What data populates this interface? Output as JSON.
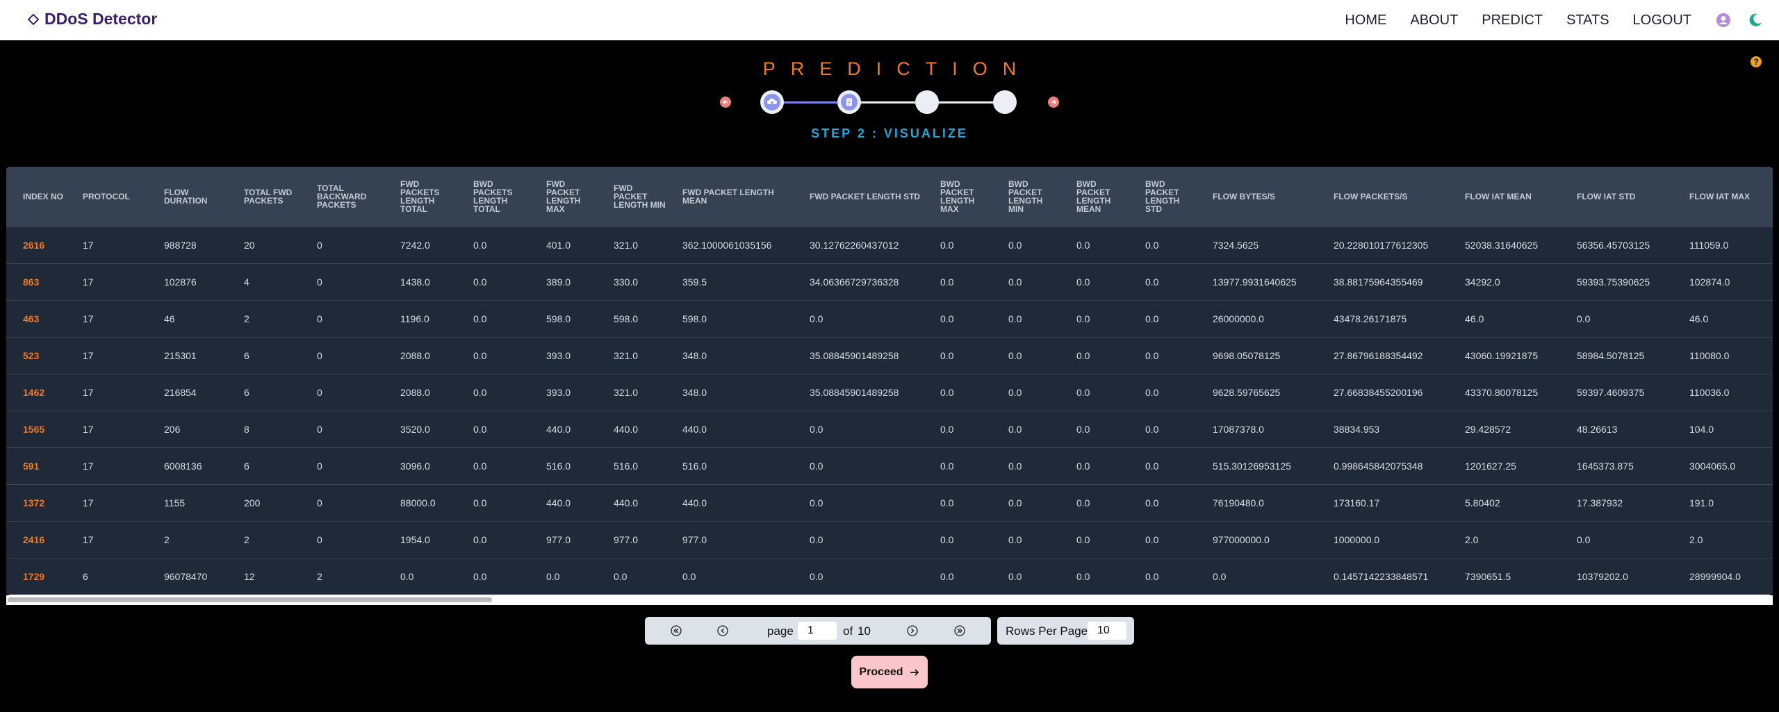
{
  "app": {
    "brand": "DDoS Detector"
  },
  "nav": {
    "items": [
      "HOME",
      "ABOUT",
      "PREDICT",
      "STATS",
      "LOGOUT"
    ]
  },
  "stepper": {
    "title": "PREDICTION",
    "step_label": "STEP 2 : VISUALIZE",
    "current_step": 2,
    "total_steps": 4
  },
  "table": {
    "headers": [
      "INDEX NO",
      "PROTOCOL",
      "FLOW DURATION",
      "TOTAL FWD PACKETS",
      "TOTAL BACKWARD PACKETS",
      "FWD PACKETS LENGTH TOTAL",
      "BWD PACKETS LENGTH TOTAL",
      "FWD PACKET LENGTH MAX",
      "FWD PACKET LENGTH MIN",
      "FWD PACKET LENGTH MEAN",
      "FWD PACKET LENGTH STD",
      "BWD PACKET LENGTH MAX",
      "BWD PACKET LENGTH MIN",
      "BWD PACKET LENGTH MEAN",
      "BWD PACKET LENGTH STD",
      "FLOW BYTES/S",
      "FLOW PACKETS/S",
      "FLOW IAT MEAN",
      "FLOW IAT STD",
      "FLOW IAT MAX"
    ],
    "rows": [
      [
        "2616",
        "17",
        "988728",
        "20",
        "0",
        "7242.0",
        "0.0",
        "401.0",
        "321.0",
        "362.1000061035156",
        "30.12762260437012",
        "0.0",
        "0.0",
        "0.0",
        "0.0",
        "7324.5625",
        "20.228010177612305",
        "52038.31640625",
        "56356.45703125",
        "111059.0"
      ],
      [
        "863",
        "17",
        "102876",
        "4",
        "0",
        "1438.0",
        "0.0",
        "389.0",
        "330.0",
        "359.5",
        "34.06366729736328",
        "0.0",
        "0.0",
        "0.0",
        "0.0",
        "13977.9931640625",
        "38.88175964355469",
        "34292.0",
        "59393.75390625",
        "102874.0"
      ],
      [
        "463",
        "17",
        "46",
        "2",
        "0",
        "1196.0",
        "0.0",
        "598.0",
        "598.0",
        "598.0",
        "0.0",
        "0.0",
        "0.0",
        "0.0",
        "0.0",
        "26000000.0",
        "43478.26171875",
        "46.0",
        "0.0",
        "46.0"
      ],
      [
        "523",
        "17",
        "215301",
        "6",
        "0",
        "2088.0",
        "0.0",
        "393.0",
        "321.0",
        "348.0",
        "35.08845901489258",
        "0.0",
        "0.0",
        "0.0",
        "0.0",
        "9698.05078125",
        "27.86796188354492",
        "43060.19921875",
        "58984.5078125",
        "110080.0"
      ],
      [
        "1462",
        "17",
        "216854",
        "6",
        "0",
        "2088.0",
        "0.0",
        "393.0",
        "321.0",
        "348.0",
        "35.08845901489258",
        "0.0",
        "0.0",
        "0.0",
        "0.0",
        "9628.59765625",
        "27.66838455200196",
        "43370.80078125",
        "59397.4609375",
        "110036.0"
      ],
      [
        "1565",
        "17",
        "206",
        "8",
        "0",
        "3520.0",
        "0.0",
        "440.0",
        "440.0",
        "440.0",
        "0.0",
        "0.0",
        "0.0",
        "0.0",
        "0.0",
        "17087378.0",
        "38834.953",
        "29.428572",
        "48.26613",
        "104.0"
      ],
      [
        "591",
        "17",
        "6008136",
        "6",
        "0",
        "3096.0",
        "0.0",
        "516.0",
        "516.0",
        "516.0",
        "0.0",
        "0.0",
        "0.0",
        "0.0",
        "0.0",
        "515.30126953125",
        "0.998645842075348",
        "1201627.25",
        "1645373.875",
        "3004065.0"
      ],
      [
        "1372",
        "17",
        "1155",
        "200",
        "0",
        "88000.0",
        "0.0",
        "440.0",
        "440.0",
        "440.0",
        "0.0",
        "0.0",
        "0.0",
        "0.0",
        "0.0",
        "76190480.0",
        "173160.17",
        "5.80402",
        "17.387932",
        "191.0"
      ],
      [
        "2416",
        "17",
        "2",
        "2",
        "0",
        "1954.0",
        "0.0",
        "977.0",
        "977.0",
        "977.0",
        "0.0",
        "0.0",
        "0.0",
        "0.0",
        "0.0",
        "977000000.0",
        "1000000.0",
        "2.0",
        "0.0",
        "2.0"
      ],
      [
        "1729",
        "6",
        "96078470",
        "12",
        "2",
        "0.0",
        "0.0",
        "0.0",
        "0.0",
        "0.0",
        "0.0",
        "0.0",
        "0.0",
        "0.0",
        "0.0",
        "0.0",
        "0.1457142233848571",
        "7390651.5",
        "10379202.0",
        "28999904.0"
      ]
    ]
  },
  "pagination": {
    "page_label": "page",
    "current_page": "1",
    "of_label": "of",
    "total_pages": "10",
    "rows_per_page_label": "Rows Per Page",
    "rows_per_page": "10"
  },
  "actions": {
    "proceed_label": "Proceed"
  },
  "colors": {
    "accent": "#f07a22",
    "step_label": "#1ea7e0",
    "header_bg": "#364152",
    "row_bg": "#202937",
    "proceed_bg": "#fcc7cc"
  }
}
